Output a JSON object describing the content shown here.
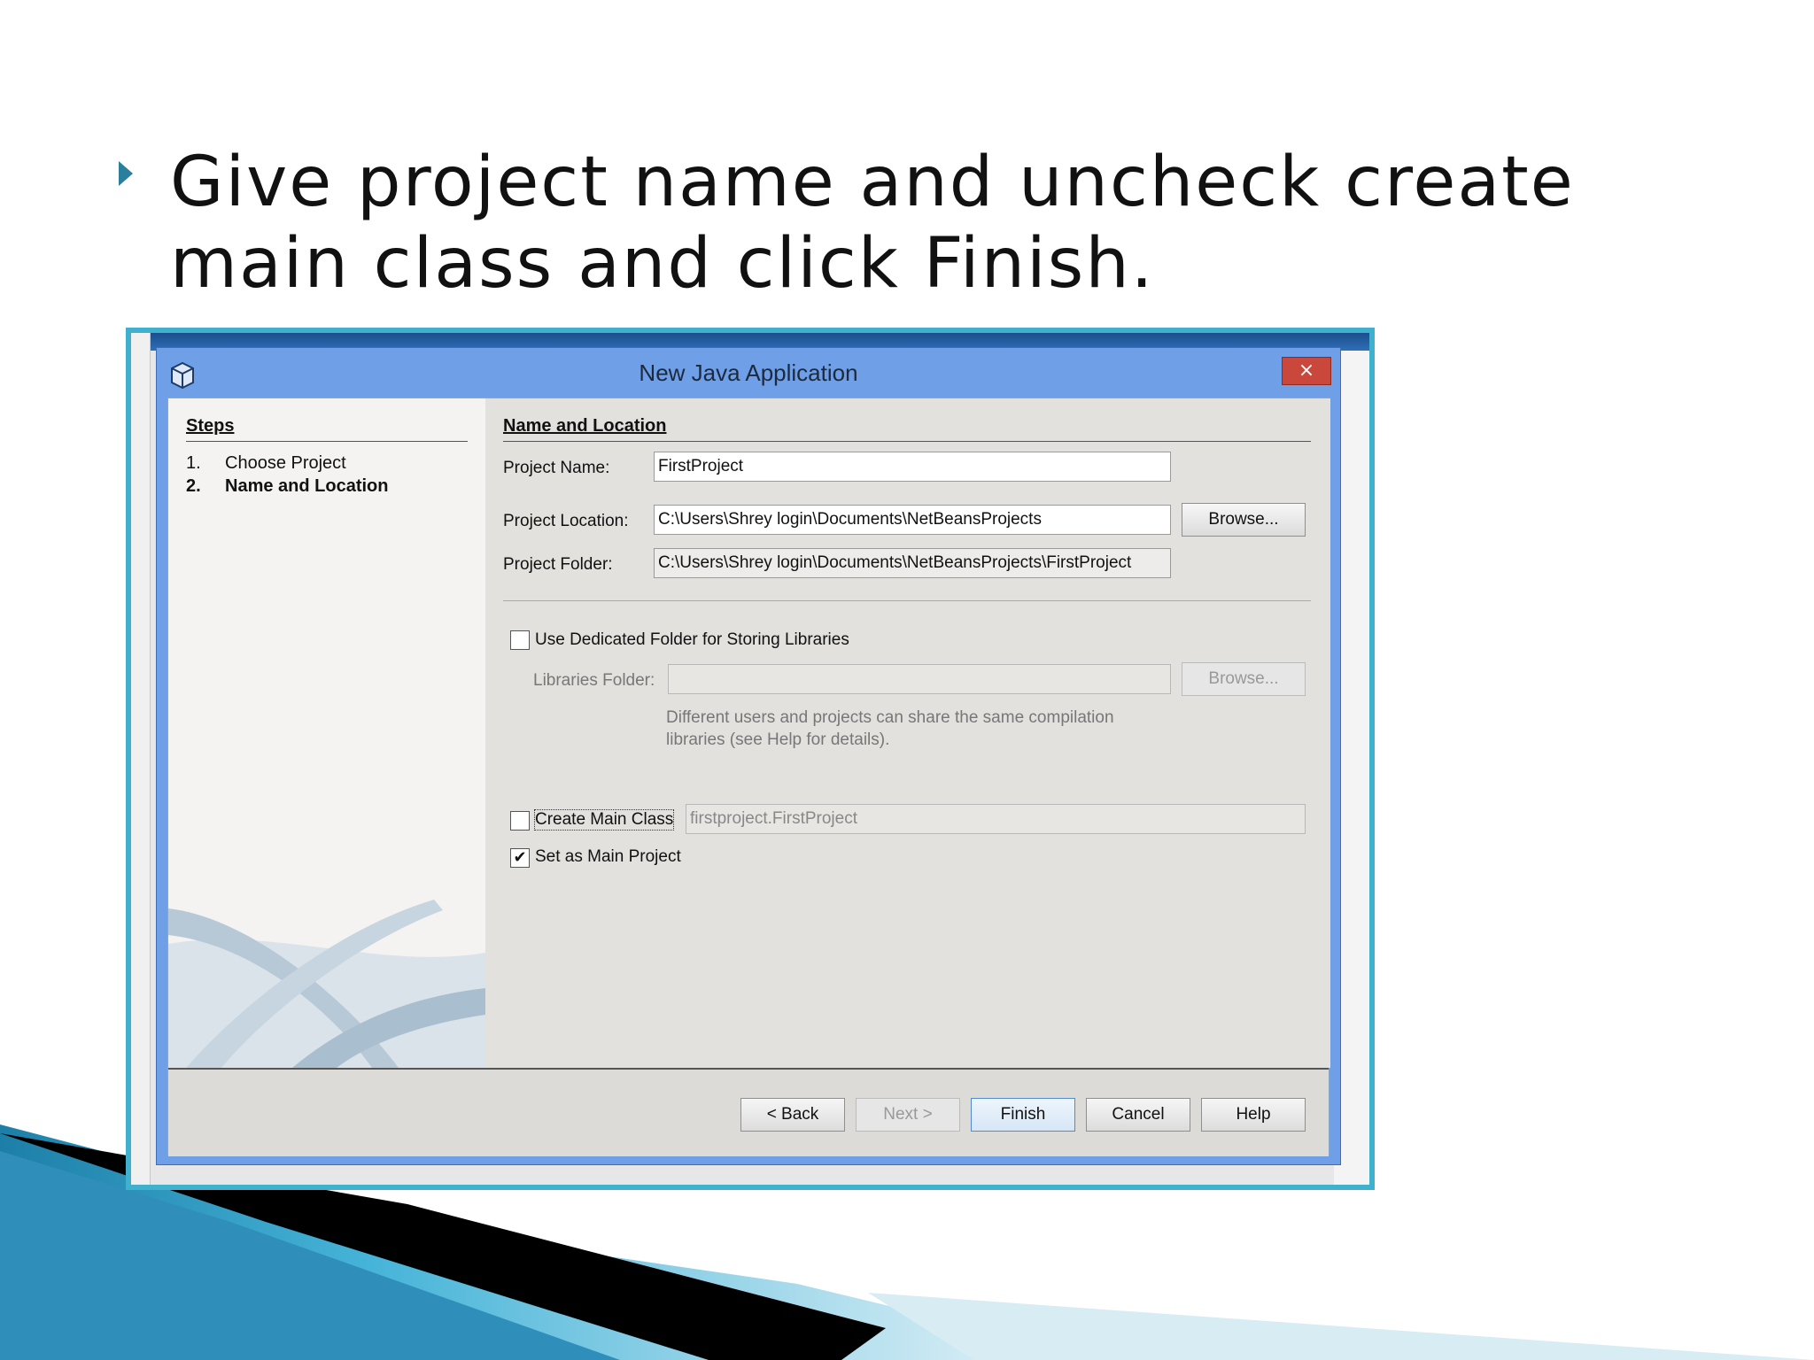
{
  "slide": {
    "bullet_text": "Give project name and uncheck create main class and click Finish."
  },
  "dialog": {
    "title": "New Java Application",
    "close_label": "×",
    "steps": {
      "title": "Steps",
      "items": [
        {
          "num": "1.",
          "label": "Choose Project"
        },
        {
          "num": "2.",
          "label": "Name and Location"
        }
      ]
    },
    "section_title": "Name and Location",
    "project_name": {
      "label": "Project Name:",
      "value": "FirstProject"
    },
    "project_location": {
      "label": "Project Location:",
      "value": "C:\\Users\\Shrey login\\Documents\\NetBeansProjects",
      "browse": "Browse..."
    },
    "project_folder": {
      "label": "Project Folder:",
      "value": "C:\\Users\\Shrey login\\Documents\\NetBeansProjects\\FirstProject"
    },
    "dedicated_folder": {
      "label": "Use Dedicated Folder for Storing Libraries",
      "checked": false
    },
    "libraries_folder": {
      "label": "Libraries Folder:",
      "value": "",
      "browse": "Browse..."
    },
    "libraries_hint_line1": "Different users and projects can share the same compilation",
    "libraries_hint_line2": "libraries (see Help for details).",
    "create_main_class": {
      "label": "Create Main Class",
      "checked": false,
      "value": "firstproject.FirstProject"
    },
    "set_main_project": {
      "label": "Set as Main Project",
      "checked": true,
      "check_glyph": "✔"
    },
    "buttons": {
      "back": "< Back",
      "next": "Next >",
      "finish": "Finish",
      "cancel": "Cancel",
      "help": "Help"
    }
  },
  "colors": {
    "accent_frame": "#3fb1cf",
    "title_bar": "#6f9fe6",
    "close_button": "#c9483b"
  }
}
